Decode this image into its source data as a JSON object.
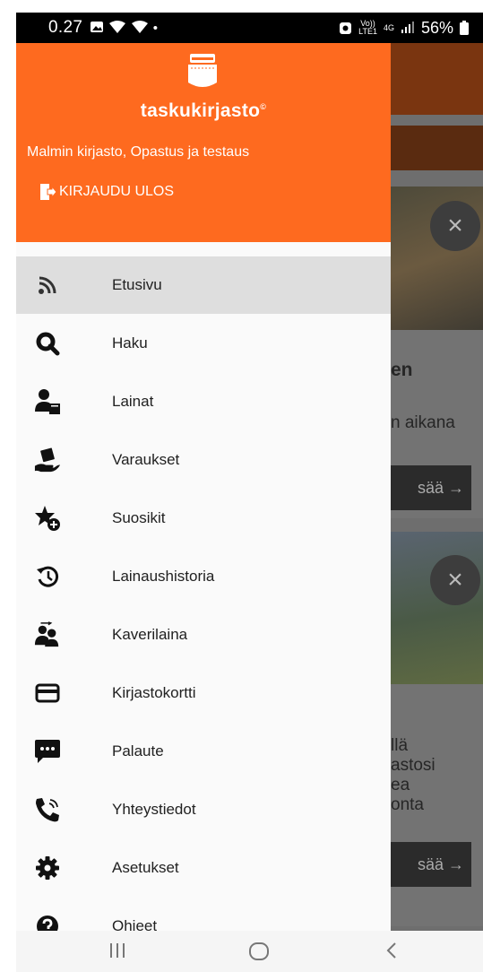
{
  "status_bar": {
    "time": "0.27",
    "left_icons": "gallery-icon wifi-icon wifi-icon dot",
    "volte_top": "Vo))",
    "volte_bottom": "LTE1",
    "network": "4G",
    "battery": "56%"
  },
  "drawer": {
    "brand": "taskukirjasto",
    "library_name": "Malmin kirjasto, Opastus ja testaus",
    "logout_label": "KIRJAUDU ULOS",
    "header_color": "#fe6a1f",
    "items": [
      {
        "label": "Etusivu",
        "icon": "rss-icon",
        "active": true
      },
      {
        "label": "Haku",
        "icon": "search-icon",
        "active": false
      },
      {
        "label": "Lainat",
        "icon": "user-book-icon",
        "active": false
      },
      {
        "label": "Varaukset",
        "icon": "hand-book-icon",
        "active": false
      },
      {
        "label": "Suosikit",
        "icon": "star-plus-icon",
        "active": false
      },
      {
        "label": "Lainaushistoria",
        "icon": "history-icon",
        "active": false
      },
      {
        "label": "Kaverilaina",
        "icon": "users-icon",
        "active": false
      },
      {
        "label": "Kirjastokortti",
        "icon": "card-icon",
        "active": false
      },
      {
        "label": "Palaute",
        "icon": "chat-icon",
        "active": false
      },
      {
        "label": "Yhteystiedot",
        "icon": "phone-icon",
        "active": false
      },
      {
        "label": "Asetukset",
        "icon": "gear-icon",
        "active": false
      },
      {
        "label": "Ohjeet",
        "icon": "help-icon",
        "active": false
      }
    ]
  },
  "background": {
    "text_en": "en",
    "text_aikana": "n aikana",
    "button1": "sää →",
    "text_lines": [
      "llä",
      "astosi",
      "ea",
      "onta"
    ],
    "button2": "sää →",
    "close": "×"
  }
}
